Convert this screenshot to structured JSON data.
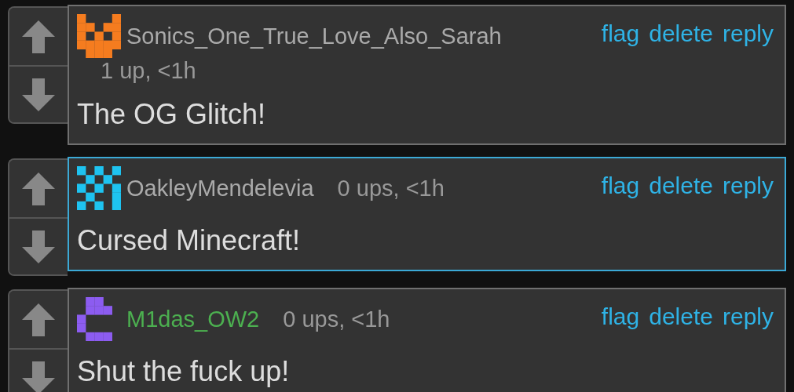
{
  "comments": [
    {
      "author": {
        "name": "Sonics_One_True_Love_Also_Sarah",
        "color": "#aaaaaa"
      },
      "avatar": {
        "color": "#f57c1f"
      },
      "meta": "1 up, <1h",
      "selected": false,
      "actions": [
        "flag",
        "delete",
        "reply"
      ],
      "text": "The OG Glitch!"
    },
    {
      "author": {
        "name": "OakleyMendelevia",
        "color": "#aaaaaa"
      },
      "avatar": {
        "color": "#1ec3f0"
      },
      "meta": "0 ups, <1h",
      "selected": true,
      "actions": [
        "flag",
        "delete",
        "reply"
      ],
      "text": "Cursed Minecraft!"
    },
    {
      "author": {
        "name": "M1das_OW2",
        "color": "#4cb050"
      },
      "avatar": {
        "color": "#8c5cf0"
      },
      "meta": "0 ups, <1h",
      "selected": false,
      "actions": [
        "flag",
        "delete",
        "reply"
      ],
      "text": "Shut the fuck up!"
    }
  ]
}
